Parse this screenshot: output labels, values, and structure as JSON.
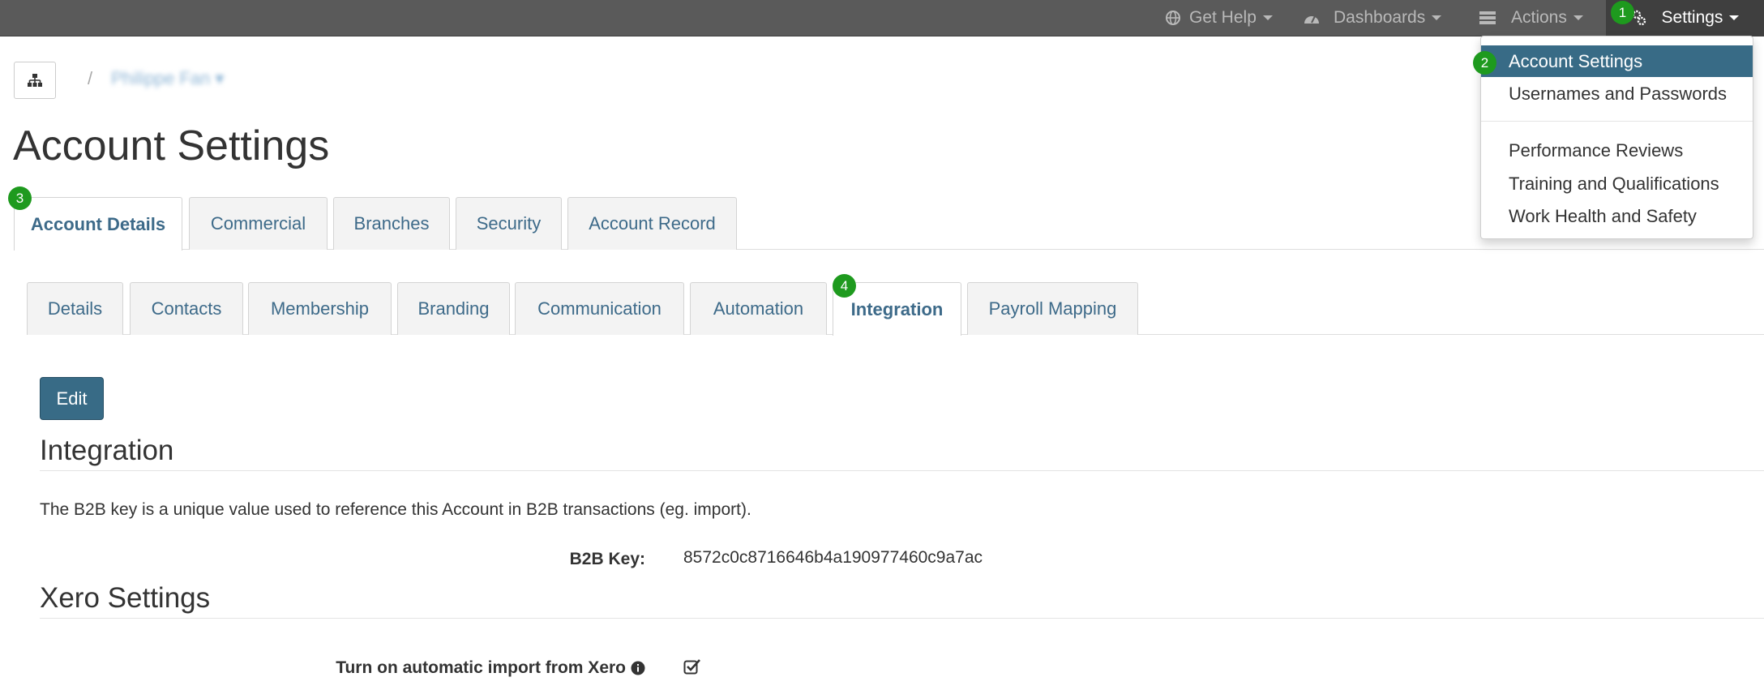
{
  "navbar": {
    "get_help": "Get Help",
    "dashboards": "Dashboards",
    "actions": "Actions",
    "settings": "Settings"
  },
  "settings_menu": {
    "items": [
      "Account Settings",
      "Usernames and Passwords",
      "Performance Reviews",
      "Training and Qualifications",
      "Work Health and Safety"
    ],
    "active": "Account Settings"
  },
  "badges": [
    "1",
    "2",
    "3",
    "4"
  ],
  "breadcrumb": {
    "separator": "/",
    "current": "Philippe Fan ▾"
  },
  "page_title": "Account Settings",
  "primary_tabs": [
    "Account Details",
    "Commercial",
    "Branches",
    "Security",
    "Account Record"
  ],
  "primary_active": "Account Details",
  "secondary_tabs": [
    "Details",
    "Contacts",
    "Membership",
    "Branding",
    "Communication",
    "Automation",
    "Integration",
    "Payroll Mapping"
  ],
  "secondary_active": "Integration",
  "edit_label": "Edit",
  "integration": {
    "heading": "Integration",
    "description": "The B2B key is a unique value used to reference this Account in B2B transactions (eg. import).",
    "b2b_key_label": "B2B Key:",
    "b2b_key_value": "8572c0c8716646b4a190977460c9a7ac"
  },
  "xero": {
    "heading": "Xero Settings",
    "auto_import_label": "Turn on automatic import from Xero",
    "auto_import_checked": true
  },
  "colors": {
    "navbar": "#5a5a5a",
    "accent": "#386b86",
    "badge": "#1e9a1e",
    "tab_text": "#3d6a89"
  }
}
